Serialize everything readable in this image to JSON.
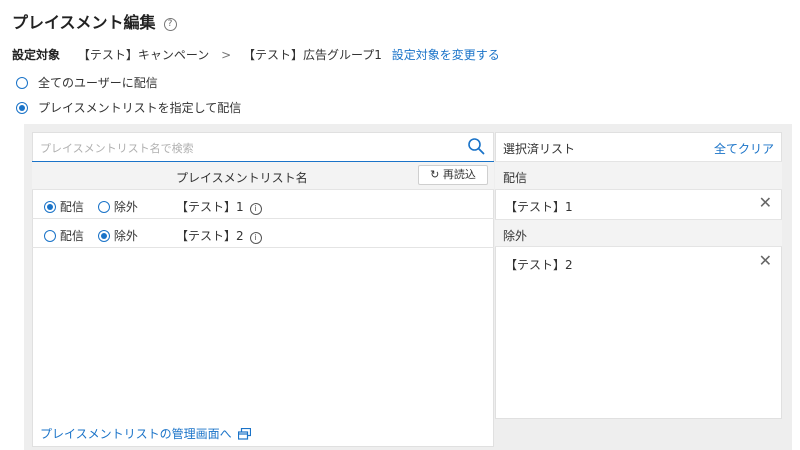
{
  "page": {
    "title": "プレイスメント編集",
    "help_icon": "?"
  },
  "target": {
    "label": "設定対象",
    "campaign": "【テスト】キャンペーン",
    "separator": ">",
    "ad_group": "【テスト】広告グループ1",
    "change_link": "設定対象を変更する"
  },
  "delivery_options": [
    {
      "label": "全てのユーザーに配信",
      "selected": false
    },
    {
      "label": "プレイスメントリストを指定して配信",
      "selected": true
    }
  ],
  "search": {
    "placeholder": "プレイスメントリスト名で検索",
    "icon": "search-icon"
  },
  "list_header": {
    "name_column": "プレイスメントリスト名",
    "reload_label": "再読込",
    "reload_icon": "↻"
  },
  "list_rows": [
    {
      "deliver_label": "配信",
      "exclude_label": "除外",
      "mode": "deliver",
      "name": "【テスト】1",
      "info": "i"
    },
    {
      "deliver_label": "配信",
      "exclude_label": "除外",
      "mode": "exclude",
      "name": "【テスト】2",
      "info": "i"
    }
  ],
  "selected_panel": {
    "title": "選択済リスト",
    "clear_all": "全てクリア",
    "deliver_section": {
      "label": "配信",
      "items": [
        "【テスト】1"
      ]
    },
    "exclude_section": {
      "label": "除外",
      "items": [
        "【テスト】2"
      ]
    },
    "remove_icon": "✕"
  },
  "footer": {
    "link_label": "プレイスメントリストの管理画面へ",
    "icon": "external-window-icon"
  },
  "colors": {
    "accent": "#1a73c8",
    "panel_bg": "#eeeeee",
    "header_bg": "#f3f3f3"
  }
}
